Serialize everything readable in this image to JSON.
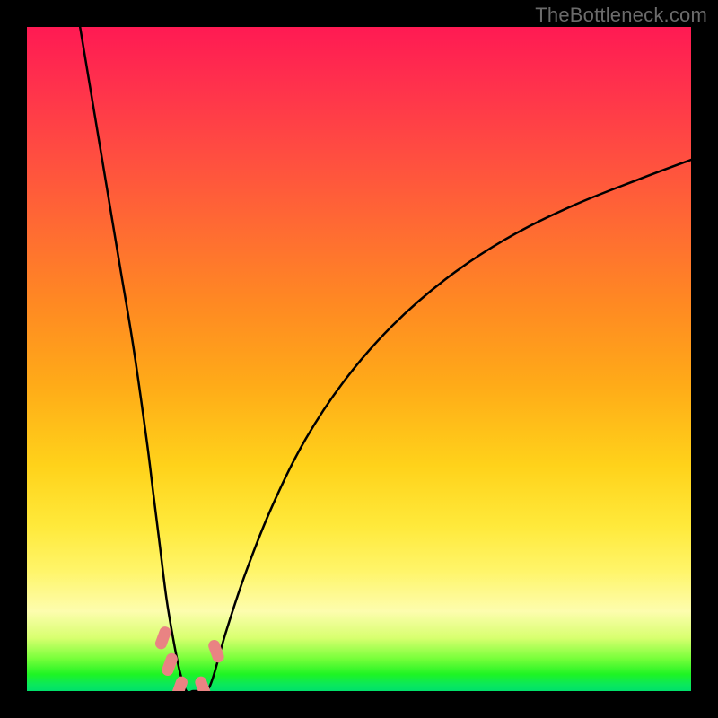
{
  "watermark": "TheBottleneck.com",
  "chart_data": {
    "type": "line",
    "title": "",
    "xlabel": "",
    "ylabel": "",
    "xlim": [
      0,
      100
    ],
    "ylim": [
      0,
      100
    ],
    "background_gradient": {
      "top_color": "#ff1a53",
      "bottom_color": "#00e06a",
      "stops": [
        {
          "pos": 0,
          "color": "#ff1a53"
        },
        {
          "pos": 30,
          "color": "#ff6a33"
        },
        {
          "pos": 66,
          "color": "#ffd21a"
        },
        {
          "pos": 88,
          "color": "#fdfdae"
        },
        {
          "pos": 100,
          "color": "#00e06a"
        }
      ]
    },
    "series": [
      {
        "name": "bottleneck-curve",
        "color": "#000000",
        "x": [
          8,
          10,
          12,
          14,
          16,
          18,
          19,
          20,
          21,
          22,
          23,
          24,
          25,
          26,
          27,
          28,
          30,
          33,
          37,
          42,
          48,
          55,
          63,
          72,
          82,
          92,
          100
        ],
        "y": [
          100,
          88,
          76,
          64,
          52,
          38,
          30,
          22,
          14,
          8,
          3,
          0,
          0,
          0,
          0,
          2,
          9,
          18,
          28,
          38,
          47,
          55,
          62,
          68,
          73,
          77,
          80
        ]
      }
    ],
    "markers": [
      {
        "name": "marker-a",
        "x": 20.5,
        "y": 8,
        "color": "#e98383"
      },
      {
        "name": "marker-b",
        "x": 21.5,
        "y": 4,
        "color": "#e98383"
      },
      {
        "name": "marker-c",
        "x": 23.0,
        "y": 0.5,
        "color": "#e98383"
      },
      {
        "name": "marker-d",
        "x": 26.5,
        "y": 0.5,
        "color": "#e98383"
      },
      {
        "name": "marker-e",
        "x": 28.5,
        "y": 6,
        "color": "#e98383"
      }
    ],
    "valley_x": 25
  }
}
